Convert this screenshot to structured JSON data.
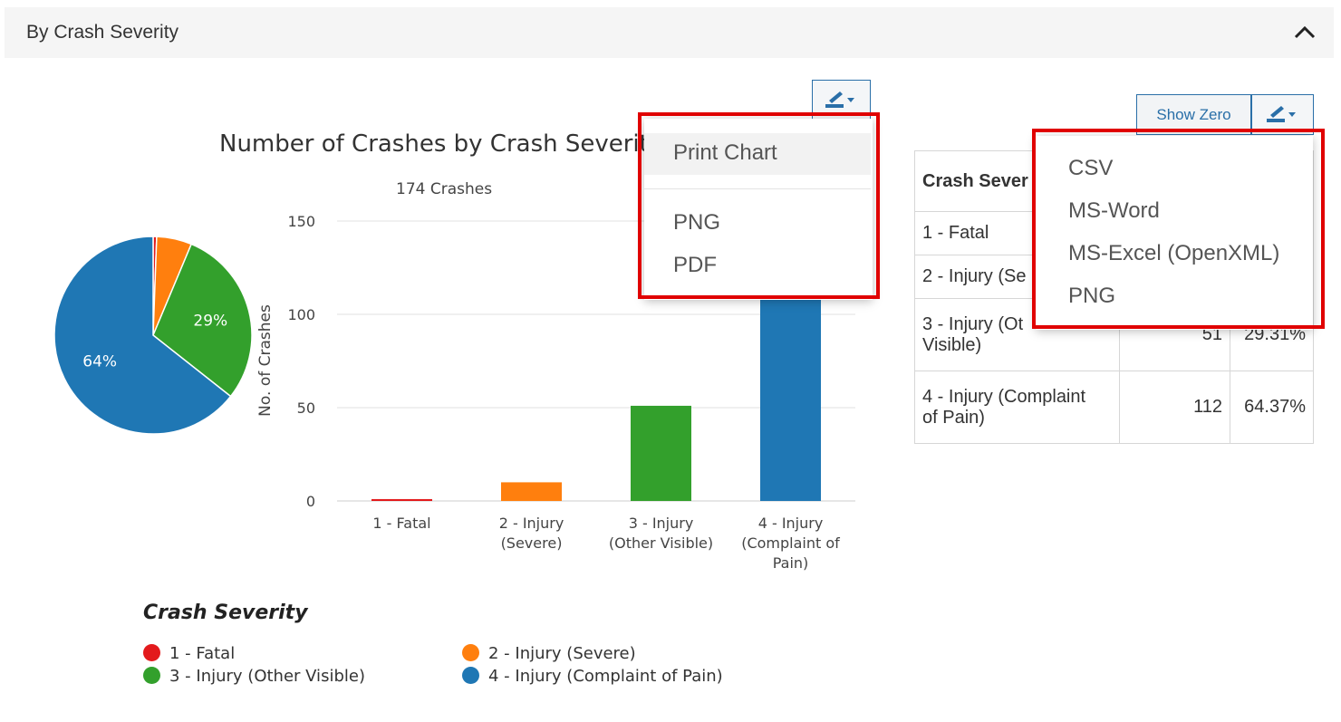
{
  "section": {
    "title": "By Crash Severity"
  },
  "chart": {
    "title": "Number of Crashes by Crash Severity",
    "subtitle": "174 Crashes",
    "ylabel": "No. of Crashes"
  },
  "chart_data": {
    "type": "bar",
    "title": "Number of Crashes by Crash Severity",
    "subtitle": "174 Crashes",
    "ylabel": "No. of Crashes",
    "ylim": [
      0,
      150
    ],
    "yticks": [
      0,
      50,
      100,
      150
    ],
    "categories": [
      "1 - Fatal",
      "2 - Injury (Severe)",
      "3 - Injury (Other Visible)",
      "4 - Injury (Complaint of Pain)"
    ],
    "category_lines": [
      [
        "1 - Fatal"
      ],
      [
        "2 - Injury",
        "(Severe)"
      ],
      [
        "3 - Injury",
        "(Other Visible)"
      ],
      [
        "4 - Injury",
        "(Complaint of",
        "Pain)"
      ]
    ],
    "values": [
      1,
      10,
      51,
      112
    ],
    "colors": [
      "#e31a1c",
      "#ff7f0e",
      "#33a02c",
      "#1f77b4"
    ],
    "pie_labels": [
      "",
      "",
      "29%",
      "64%"
    ],
    "grid": true
  },
  "legend": {
    "title": "Crash Severity",
    "items": [
      {
        "label": "1 - Fatal",
        "color": "#e31a1c"
      },
      {
        "label": "2 - Injury (Severe)",
        "color": "#ff7f0e"
      },
      {
        "label": "3 - Injury (Other Visible)",
        "color": "#33a02c"
      },
      {
        "label": "4 - Injury (Complaint of Pain)",
        "color": "#1f77b4"
      }
    ]
  },
  "table": {
    "header": "Crash Sever",
    "rows": [
      {
        "label": "1 - Fatal",
        "count": "",
        "pct": ""
      },
      {
        "label": "2 - Injury (Se",
        "count": "",
        "pct": ""
      },
      {
        "label": "3 - Injury (Ot Visible)",
        "label_line1": "3 - Injury (Ot",
        "label_line2": "Visible)",
        "count": "51",
        "pct": "29.31%"
      },
      {
        "label_line1": "4 - Injury (Complaint",
        "label_line2": "of Pain)",
        "count": "112",
        "pct": "64.37%"
      }
    ]
  },
  "buttons": {
    "show_zero": "Show Zero"
  },
  "chart_menu": {
    "items": [
      "Print Chart",
      "PNG",
      "PDF"
    ]
  },
  "table_menu": {
    "items": [
      "CSV",
      "MS-Word",
      "MS-Excel (OpenXML)",
      "PNG"
    ]
  },
  "colors": {
    "accent": "#2a6fa8",
    "highlight": "#e00000"
  }
}
